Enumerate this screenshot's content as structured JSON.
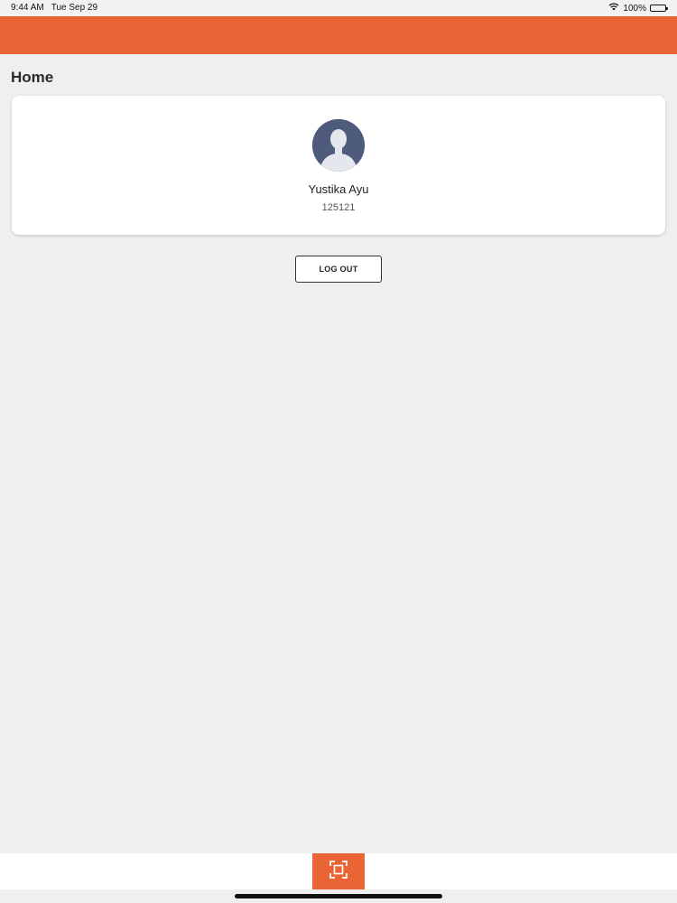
{
  "status_bar": {
    "time": "9:44 AM",
    "date": "Tue Sep 29",
    "battery_percent": "100%",
    "wifi_icon": "wifi-icon",
    "battery_icon": "battery-icon"
  },
  "colors": {
    "accent": "#e96536",
    "background": "#efefef",
    "card": "#ffffff"
  },
  "page": {
    "title": "Home"
  },
  "profile": {
    "avatar_icon": "user-avatar-icon",
    "name": "Yustika Ayu",
    "id": "125121"
  },
  "actions": {
    "logout_label": "LOG OUT"
  },
  "bottom_bar": {
    "scan_icon": "scan-icon"
  }
}
